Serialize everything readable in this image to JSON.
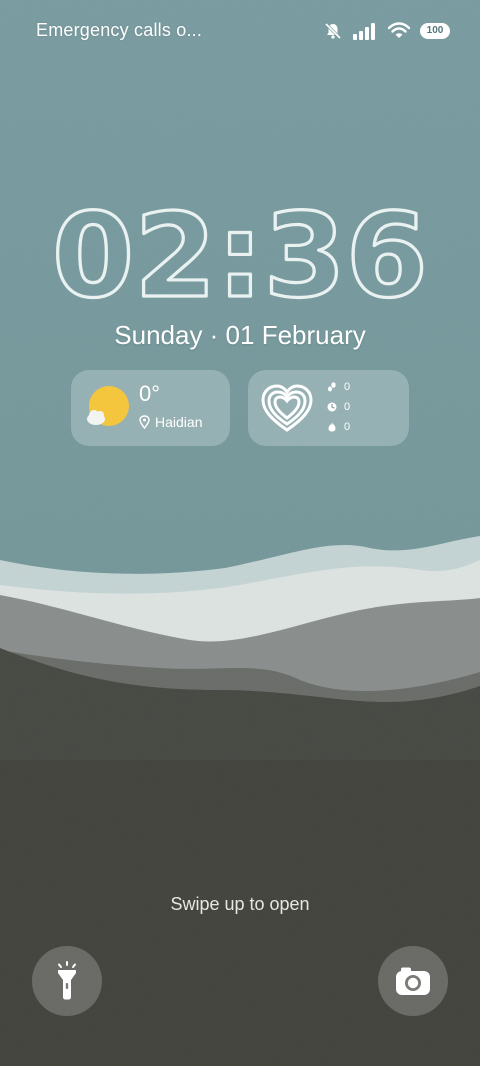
{
  "status_bar": {
    "carrier_text": "Emergency calls o...",
    "battery_level": "100",
    "icons": [
      "mute-bell-icon",
      "cellular-signal-icon",
      "wifi-icon",
      "battery-icon"
    ]
  },
  "lockscreen": {
    "time": "02:36",
    "date": "Sunday · 01 February"
  },
  "weather": {
    "temperature": "0°",
    "location": "Haidian",
    "icon": "partly-cloudy-icon"
  },
  "activity": {
    "icon": "heart-rings-icon",
    "steps": "0",
    "duration": "0",
    "calories": "0"
  },
  "hint": {
    "text": "Swipe up to open"
  },
  "shortcuts": {
    "left": "flashlight-icon",
    "right": "camera-icon"
  },
  "colors": {
    "sky": "#799ca1",
    "ground": "#454740",
    "sun": "#f4c63d",
    "accent_text": "#ffffff"
  }
}
